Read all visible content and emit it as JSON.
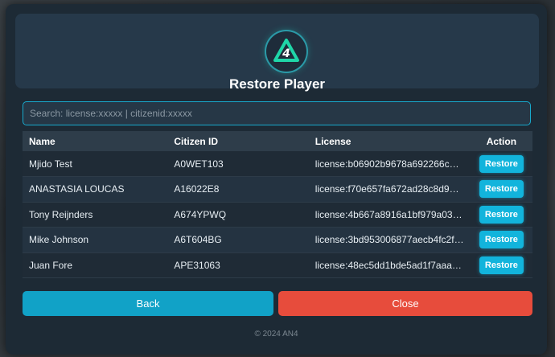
{
  "header": {
    "logo_icon": "an4-triangle-logo",
    "title": "Restore Player"
  },
  "search": {
    "placeholder": "Search: license:xxxxx | citizenid:xxxxx",
    "value": ""
  },
  "table": {
    "columns": [
      "Name",
      "Citizen ID",
      "License",
      "Action"
    ],
    "rows": [
      {
        "name": "Mjido Test",
        "citizen_id": "A0WET103",
        "license": "license:b06902b9678a692266c4f1...",
        "action": "Restore"
      },
      {
        "name": "ANASTASIA LOUCAS",
        "citizen_id": "A16022E8",
        "license": "license:f70e657fa672ad28c8d93c...",
        "action": "Restore"
      },
      {
        "name": "Tony Reijnders",
        "citizen_id": "A674YPWQ",
        "license": "license:4b667a8916a1bf979a0347...",
        "action": "Restore"
      },
      {
        "name": "Mike Johnson",
        "citizen_id": "A6T604BG",
        "license": "license:3bd953006877aecb4fc2fe...",
        "action": "Restore"
      },
      {
        "name": "Juan Fore",
        "citizen_id": "APE31063",
        "license": "license:48ec5dd1bde5ad1f7aaafb...",
        "action": "Restore"
      }
    ]
  },
  "buttons": {
    "back": "Back",
    "close": "Close"
  },
  "footer": {
    "text": "© 2024 AN4"
  },
  "colors": {
    "accent": "#12b4dc",
    "danger": "#e74c3c",
    "panel": "#1d2a35",
    "header": "#26394a"
  }
}
